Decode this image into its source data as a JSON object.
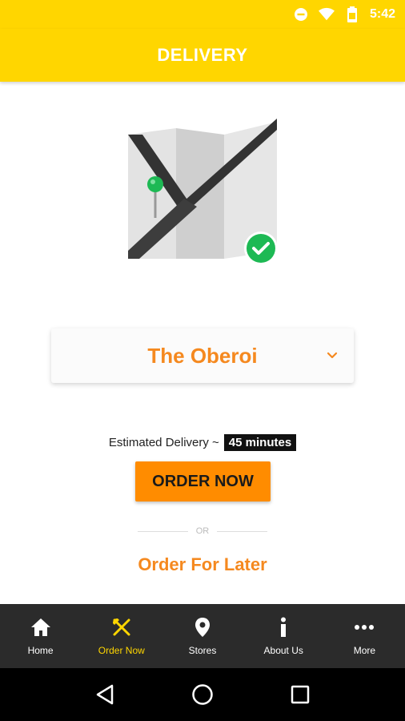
{
  "status_bar": {
    "time": "5:42",
    "icons": [
      "do-not-disturb-icon",
      "wifi-icon",
      "battery-icon"
    ]
  },
  "header": {
    "title": "DELIVERY"
  },
  "illustration": {
    "name": "map-with-pin-and-check",
    "pin_color": "#1DB954",
    "check_color": "#1DB954"
  },
  "store_selector": {
    "selected": "The Oberoi",
    "icon": "chevron-down-icon"
  },
  "delivery": {
    "label": "Estimated Delivery ~",
    "time": "45 minutes"
  },
  "actions": {
    "order_now": "ORDER NOW",
    "or_text": "OR",
    "order_later": "Order For Later"
  },
  "bottom_nav": {
    "items": [
      {
        "label": "Home",
        "icon": "home-icon"
      },
      {
        "label": "Order Now",
        "icon": "fork-knife-icon",
        "active": true
      },
      {
        "label": "Stores",
        "icon": "location-pin-icon"
      },
      {
        "label": "About Us",
        "icon": "info-icon"
      },
      {
        "label": "More",
        "icon": "more-dots-icon"
      }
    ]
  },
  "system_nav": {
    "buttons": [
      "back-icon",
      "home-circle-icon",
      "recents-icon"
    ]
  },
  "colors": {
    "brand_yellow": "#FFD600",
    "accent_orange": "#F5891F",
    "button_orange": "#FF8C00",
    "nav_background": "#2b2b2b"
  }
}
